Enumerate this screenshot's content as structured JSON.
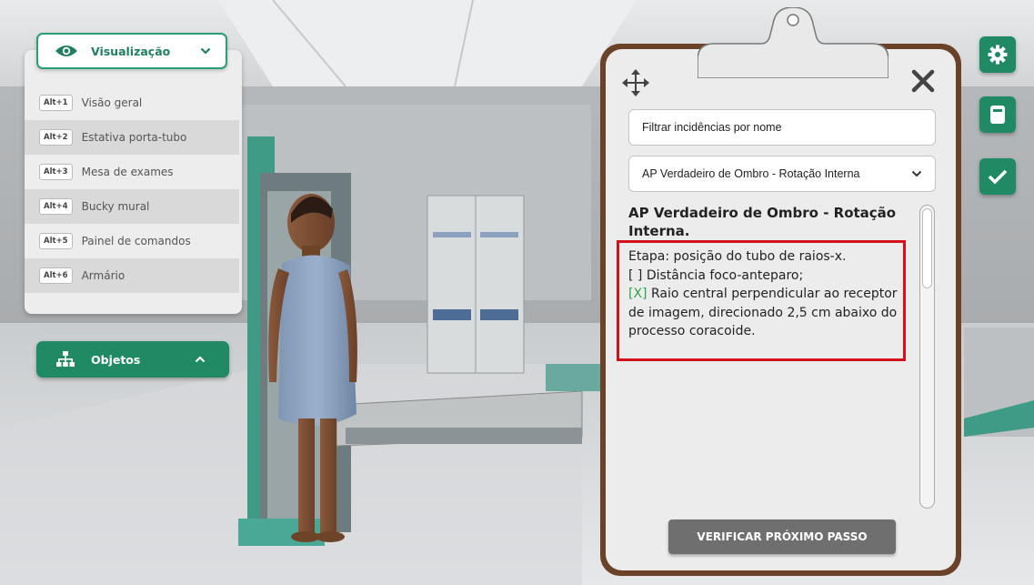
{
  "visualization": {
    "title": "Visualização",
    "items": [
      {
        "shortcut": "Alt+1",
        "label": "Visão geral"
      },
      {
        "shortcut": "Alt+2",
        "label": "Estativa porta-tubo"
      },
      {
        "shortcut": "Alt+3",
        "label": "Mesa de exames"
      },
      {
        "shortcut": "Alt+4",
        "label": "Bucky mural"
      },
      {
        "shortcut": "Alt+5",
        "label": "Painel de comandos"
      },
      {
        "shortcut": "Alt+6",
        "label": "Armário"
      }
    ]
  },
  "objects": {
    "label": "Objetos"
  },
  "toolbar": {
    "icons": [
      "gear-icon",
      "notebook-icon",
      "checkmark-icon"
    ],
    "accent_color": "#1f8a63"
  },
  "clipboard": {
    "filter_placeholder": "Filtrar incidências por nome",
    "selected_incidence": "AP Verdadeiro de Ombro - Rotação Interna",
    "title": "AP Verdadeiro de Ombro - Rotação Interna.",
    "stage": "Etapa: posição do tubo de raios-x.",
    "steps": [
      {
        "mark": "[ ]",
        "text": "Distância foco-anteparo;"
      },
      {
        "mark": "[X]",
        "text": "Raio central perpendicular ao receptor de imagem, direcionado 2,5 cm abaixo do processo coracoide."
      }
    ],
    "verify_button": "VERIFICAR PRÓXIMO PASSO",
    "highlight_color": "#d4101c",
    "frame_color": "#6b4228"
  }
}
